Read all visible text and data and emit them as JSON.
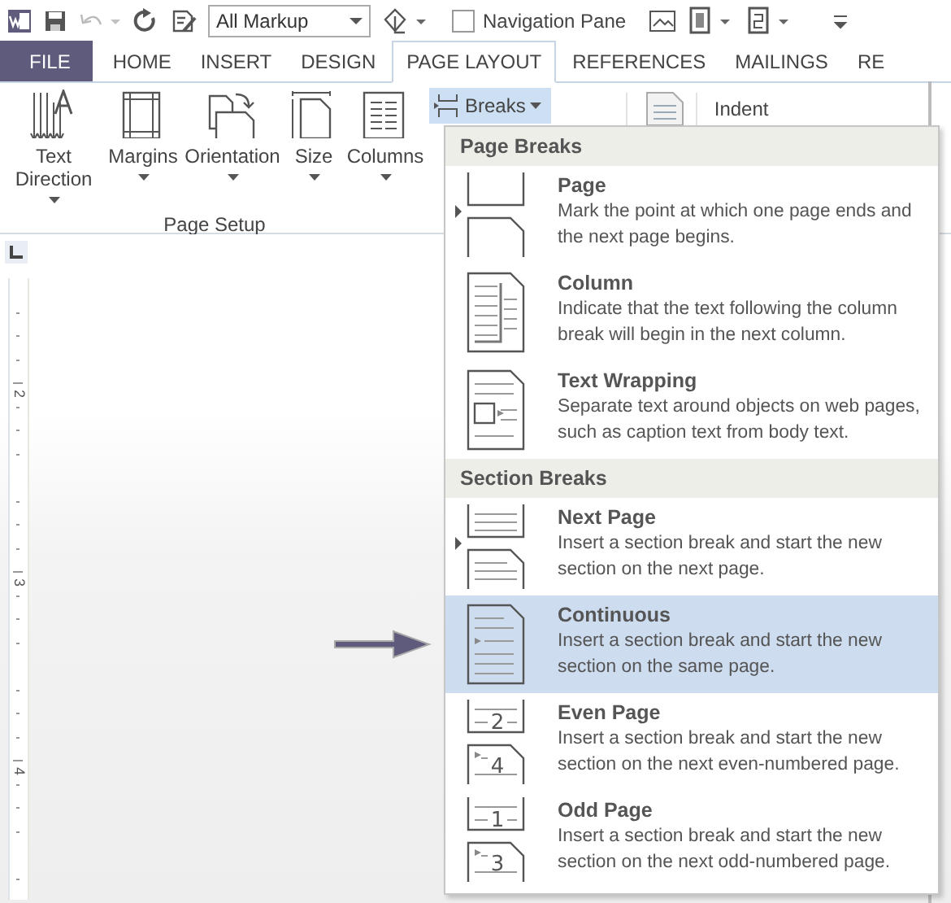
{
  "quick_access": {
    "undo_disabled": true,
    "markup": "All Markup",
    "navigation_pane": {
      "label": "Navigation Pane",
      "checked": false
    }
  },
  "tabs": [
    {
      "label": "FILE",
      "kind": "file",
      "selected": false
    },
    {
      "label": "HOME",
      "kind": "tab",
      "selected": false
    },
    {
      "label": "INSERT",
      "kind": "tab",
      "selected": false
    },
    {
      "label": "DESIGN",
      "kind": "tab",
      "selected": false
    },
    {
      "label": "PAGE LAYOUT",
      "kind": "tab",
      "selected": true
    },
    {
      "label": "REFERENCES",
      "kind": "tab",
      "selected": false
    },
    {
      "label": "MAILINGS",
      "kind": "tab",
      "selected": false
    },
    {
      "label": "RE",
      "kind": "tab",
      "selected": false
    }
  ],
  "ribbon": {
    "group": "Page Setup",
    "buttons": [
      {
        "label": "Text Direction",
        "kind": "text-direction"
      },
      {
        "label": "Margins",
        "kind": "margins"
      },
      {
        "label": "Orientation",
        "kind": "orientation"
      },
      {
        "label": "Size",
        "kind": "size"
      },
      {
        "label": "Columns",
        "kind": "columns"
      }
    ],
    "breaks": {
      "label": "Breaks",
      "open": true
    },
    "indent": "Indent"
  },
  "ruler": {
    "labels": [
      "2",
      "3",
      "4"
    ]
  },
  "breaks_menu": {
    "sections": [
      {
        "title": "Page Breaks",
        "items": [
          {
            "kind": "page",
            "title": "Page",
            "description": "Mark the point at which one page ends and the next page begins.",
            "selected": false
          },
          {
            "kind": "column",
            "title": "Column",
            "description": "Indicate that the text following the column break will begin in the next column.",
            "selected": false
          },
          {
            "kind": "text-wrapping",
            "title": "Text Wrapping",
            "description": "Separate text around objects on web pages, such as caption text from body text.",
            "selected": false
          }
        ]
      },
      {
        "title": "Section Breaks",
        "items": [
          {
            "kind": "next-page",
            "title": "Next Page",
            "description": "Insert a section break and start the new section on the next page.",
            "selected": false
          },
          {
            "kind": "continuous",
            "title": "Continuous",
            "description": "Insert a section break and start the new section on the same page.",
            "selected": true
          },
          {
            "kind": "numbered",
            "title": "Even Page",
            "description": "Insert a section break and start the new section on the next even-numbered page.",
            "icon_numbers": [
              "2",
              "4"
            ],
            "selected": false
          },
          {
            "kind": "numbered",
            "title": "Odd Page",
            "description": "Insert a section break and start the new section on the next odd-numbered page.",
            "icon_numbers": [
              "1",
              "3"
            ],
            "selected": false
          }
        ]
      }
    ]
  }
}
